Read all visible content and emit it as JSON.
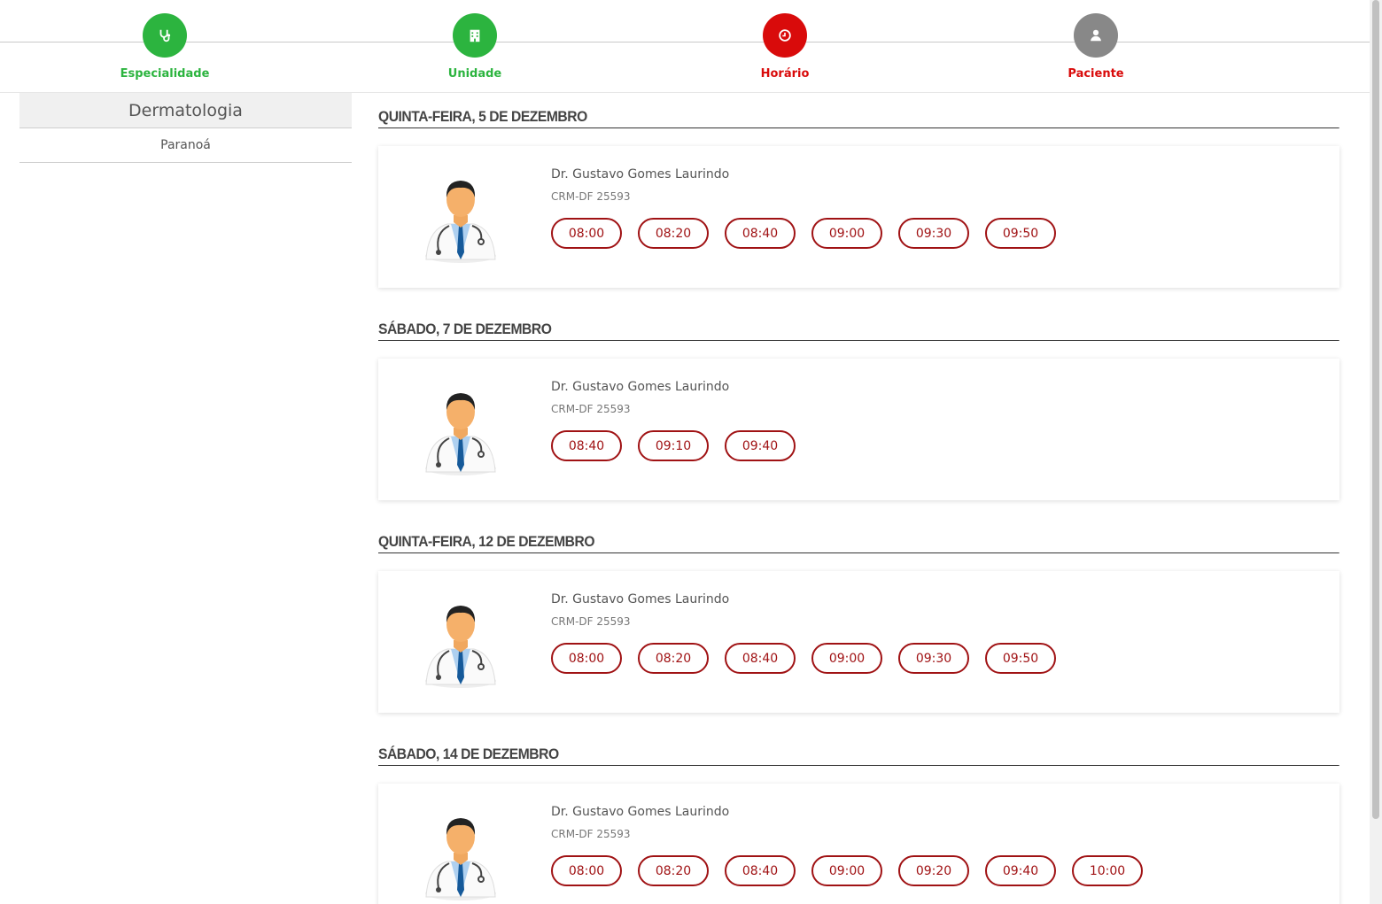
{
  "colors": {
    "done": "#2cb43f",
    "active": "#d90b0b",
    "pending": "#888888",
    "slot": "#a01214"
  },
  "steps": [
    {
      "label": "Especialidade",
      "icon": "stethoscope-icon",
      "state": "done"
    },
    {
      "label": "Unidade",
      "icon": "hospital-building-icon",
      "state": "done"
    },
    {
      "label": "Horário",
      "icon": "clock-icon",
      "state": "active"
    },
    {
      "label": "Paciente",
      "icon": "user-icon",
      "state": "pending"
    }
  ],
  "sidebar": {
    "specialty": "Dermatologia",
    "unit": "Paranoá"
  },
  "days": [
    {
      "date": "QUINTA-FEIRA, 5 DE DEZEMBRO",
      "doctor": {
        "name": "Dr. Gustavo Gomes Laurindo",
        "crm": "CRM-DF 25593"
      },
      "slots": [
        "08:00",
        "08:20",
        "08:40",
        "09:00",
        "09:30",
        "09:50"
      ]
    },
    {
      "date": "SÁBADO, 7 DE DEZEMBRO",
      "doctor": {
        "name": "Dr. Gustavo Gomes Laurindo",
        "crm": "CRM-DF 25593"
      },
      "slots": [
        "08:40",
        "09:10",
        "09:40"
      ]
    },
    {
      "date": "QUINTA-FEIRA, 12 DE DEZEMBRO",
      "doctor": {
        "name": "Dr. Gustavo Gomes Laurindo",
        "crm": "CRM-DF 25593"
      },
      "slots": [
        "08:00",
        "08:20",
        "08:40",
        "09:00",
        "09:30",
        "09:50"
      ]
    },
    {
      "date": "SÁBADO, 14 DE DEZEMBRO",
      "doctor": {
        "name": "Dr. Gustavo Gomes Laurindo",
        "crm": "CRM-DF 25593"
      },
      "slots": [
        "08:00",
        "08:20",
        "08:40",
        "09:00",
        "09:20",
        "09:40",
        "10:00"
      ]
    }
  ]
}
